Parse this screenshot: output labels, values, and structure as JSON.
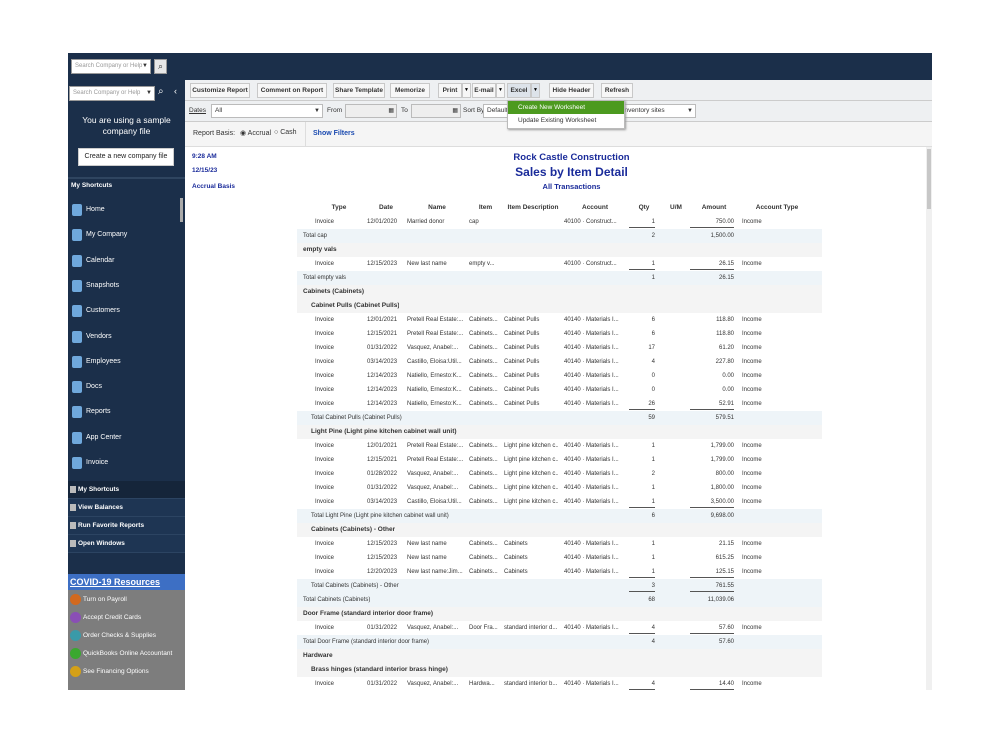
{
  "topbar": {
    "search_placeholder": "Search Company or Help"
  },
  "sidebar": {
    "search_placeholder": "Search Company or Help",
    "sample_text": "You are using a sample company file",
    "create_button": "Create a new company file",
    "shortcuts_header": "My Shortcuts",
    "items": [
      {
        "label": "Home"
      },
      {
        "label": "My Company"
      },
      {
        "label": "Calendar"
      },
      {
        "label": "Snapshots"
      },
      {
        "label": "Customers"
      },
      {
        "label": "Vendors"
      },
      {
        "label": "Employees"
      },
      {
        "label": "Docs"
      },
      {
        "label": "Reports"
      },
      {
        "label": "App Center"
      },
      {
        "label": "Invoice"
      }
    ],
    "bottom_nav": [
      {
        "label": "My Shortcuts"
      },
      {
        "label": "View Balances"
      },
      {
        "label": "Run Favorite Reports"
      },
      {
        "label": "Open Windows"
      }
    ],
    "covid_header": "COVID-19 Resources",
    "resources": [
      {
        "label": "Turn on Payroll",
        "color": "#d2691e"
      },
      {
        "label": "Accept Credit Cards",
        "color": "#8a4fb5"
      },
      {
        "label": "Order Checks & Supplies",
        "color": "#3a9aa8"
      },
      {
        "label": "QuickBooks Online Accountant",
        "color": "#3aa82f"
      },
      {
        "label": "See Financing Options",
        "color": "#d4a017"
      }
    ]
  },
  "toolbar": {
    "customize": "Customize Report",
    "comment": "Comment on Report",
    "share": "Share Template",
    "memorize": "Memorize",
    "print": "Print",
    "email": "E-mail",
    "excel": "Excel",
    "hide_header": "Hide Header",
    "refresh": "Refresh"
  },
  "excel_menu": {
    "items": [
      "Create New Worksheet",
      "Update Existing Worksheet"
    ]
  },
  "filters": {
    "dates_label": "Dates",
    "dates_value": "All",
    "from_label": "From",
    "to_label": "To",
    "sort_label": "Sort By",
    "sort_value": "Default",
    "sites_value": "All inventory sites"
  },
  "basis": {
    "label": "Report Basis:",
    "accrual": "Accrual",
    "cash": "Cash",
    "show_filters": "Show Filters"
  },
  "report": {
    "time": "9:28 AM",
    "date": "12/15/23",
    "basis": "Accrual Basis",
    "company": "Rock Castle Construction",
    "title": "Sales by Item Detail",
    "subtitle": "All Transactions",
    "columns": [
      "Type",
      "Date",
      "Name",
      "Item",
      "Item Description",
      "Account",
      "Qty",
      "U/M",
      "Amount",
      "Account Type"
    ],
    "rows": [
      {
        "k": "t",
        "c": [
          "Invoice",
          "12/01/2020",
          "Married donor",
          "cap",
          "",
          "40100 · Construct...",
          "1",
          "",
          "750.00",
          "Income"
        ],
        "u": 1
      },
      {
        "k": "s",
        "label": "Total cap",
        "qty": "2",
        "amt": "1,500.00"
      },
      {
        "k": "g",
        "label": "empty vals"
      },
      {
        "k": "t",
        "c": [
          "Invoice",
          "12/15/2023",
          "New last name",
          "empty v...",
          "",
          "40100 · Construct...",
          "1",
          "",
          "26.15",
          "Income"
        ],
        "u": 1
      },
      {
        "k": "s",
        "label": "Total empty vals",
        "qty": "1",
        "amt": "26.15"
      },
      {
        "k": "g",
        "label": "Cabinets (Cabinets)"
      },
      {
        "k": "g",
        "label": "Cabinet Pulls (Cabinet Pulls)",
        "i": 1
      },
      {
        "k": "t",
        "c": [
          "Invoice",
          "12/01/2021",
          "Pretell Real Estate:...",
          "Cabinets...",
          "Cabinet Pulls",
          "40140 · Materials I...",
          "6",
          "",
          "118.80",
          "Income"
        ]
      },
      {
        "k": "t",
        "c": [
          "Invoice",
          "12/15/2021",
          "Pretell Real Estate:...",
          "Cabinets...",
          "Cabinet Pulls",
          "40140 · Materials I...",
          "6",
          "",
          "118.80",
          "Income"
        ]
      },
      {
        "k": "t",
        "c": [
          "Invoice",
          "01/31/2022",
          "Vasquez, Anabel:...",
          "Cabinets...",
          "Cabinet Pulls",
          "40140 · Materials I...",
          "17",
          "",
          "61.20",
          "Income"
        ]
      },
      {
        "k": "t",
        "c": [
          "Invoice",
          "03/14/2023",
          "Castillo, Eloisa:Util...",
          "Cabinets...",
          "Cabinet Pulls",
          "40140 · Materials I...",
          "4",
          "",
          "227.80",
          "Income"
        ]
      },
      {
        "k": "t",
        "c": [
          "Invoice",
          "12/14/2023",
          "Natiello, Ernesto:K...",
          "Cabinets...",
          "Cabinet Pulls",
          "40140 · Materials I...",
          "0",
          "",
          "0.00",
          "Income"
        ]
      },
      {
        "k": "t",
        "c": [
          "Invoice",
          "12/14/2023",
          "Natiello, Ernesto:K...",
          "Cabinets...",
          "Cabinet Pulls",
          "40140 · Materials I...",
          "0",
          "",
          "0.00",
          "Income"
        ]
      },
      {
        "k": "t",
        "c": [
          "Invoice",
          "12/14/2023",
          "Natiello, Ernesto:K...",
          "Cabinets...",
          "Cabinet Pulls",
          "40140 · Materials I...",
          "26",
          "",
          "52.91",
          "Income"
        ],
        "u": 1
      },
      {
        "k": "s",
        "label": "Total Cabinet Pulls (Cabinet Pulls)",
        "qty": "59",
        "amt": "579.51",
        "i": 1
      },
      {
        "k": "g",
        "label": "Light Pine (Light pine kitchen cabinet wall unit)",
        "i": 1
      },
      {
        "k": "t",
        "c": [
          "Invoice",
          "12/01/2021",
          "Pretell Real Estate:...",
          "Cabinets...",
          "Light pine kitchen c...",
          "40140 · Materials I...",
          "1",
          "",
          "1,799.00",
          "Income"
        ]
      },
      {
        "k": "t",
        "c": [
          "Invoice",
          "12/15/2021",
          "Pretell Real Estate:...",
          "Cabinets...",
          "Light pine kitchen c...",
          "40140 · Materials I...",
          "1",
          "",
          "1,799.00",
          "Income"
        ]
      },
      {
        "k": "t",
        "c": [
          "Invoice",
          "01/28/2022",
          "Vasquez, Anabel:...",
          "Cabinets...",
          "Light pine kitchen c...",
          "40140 · Materials I...",
          "2",
          "",
          "800.00",
          "Income"
        ]
      },
      {
        "k": "t",
        "c": [
          "Invoice",
          "01/31/2022",
          "Vasquez, Anabel:...",
          "Cabinets...",
          "Light pine kitchen c...",
          "40140 · Materials I...",
          "1",
          "",
          "1,800.00",
          "Income"
        ]
      },
      {
        "k": "t",
        "c": [
          "Invoice",
          "03/14/2023",
          "Castillo, Eloisa:Util...",
          "Cabinets...",
          "Light pine kitchen c...",
          "40140 · Materials I...",
          "1",
          "",
          "3,500.00",
          "Income"
        ],
        "u": 1
      },
      {
        "k": "s",
        "label": "Total Light Pine (Light pine kitchen cabinet wall unit)",
        "qty": "6",
        "amt": "9,698.00",
        "i": 1
      },
      {
        "k": "g",
        "label": "Cabinets (Cabinets) - Other",
        "i": 1
      },
      {
        "k": "t",
        "c": [
          "Invoice",
          "12/15/2023",
          "New last name",
          "Cabinets...",
          "Cabinets",
          "40140 · Materials I...",
          "1",
          "",
          "21.15",
          "Income"
        ]
      },
      {
        "k": "t",
        "c": [
          "Invoice",
          "12/15/2023",
          "New last name",
          "Cabinets...",
          "Cabinets",
          "40140 · Materials I...",
          "1",
          "",
          "615.25",
          "Income"
        ]
      },
      {
        "k": "t",
        "c": [
          "Invoice",
          "12/20/2023",
          "New last name:Jim...",
          "Cabinets...",
          "Cabinets",
          "40140 · Materials I...",
          "1",
          "",
          "125.15",
          "Income"
        ],
        "u": 1
      },
      {
        "k": "s",
        "label": "Total Cabinets (Cabinets) - Other",
        "qty": "3",
        "amt": "761.55",
        "i": 1,
        "u": 1
      },
      {
        "k": "s",
        "label": "Total Cabinets (Cabinets)",
        "qty": "68",
        "amt": "11,039.06"
      },
      {
        "k": "g",
        "label": "Door Frame (standard interior door frame)"
      },
      {
        "k": "t",
        "c": [
          "Invoice",
          "01/31/2022",
          "Vasquez, Anabel:...",
          "Door Fra...",
          "standard interior d...",
          "40140 · Materials I...",
          "4",
          "",
          "57.60",
          "Income"
        ],
        "u": 1
      },
      {
        "k": "s",
        "label": "Total Door Frame (standard interior door frame)",
        "qty": "4",
        "amt": "57.60"
      },
      {
        "k": "g",
        "label": "Hardware"
      },
      {
        "k": "g",
        "label": "Brass hinges (standard interior brass hinge)",
        "i": 1
      },
      {
        "k": "t",
        "c": [
          "Invoice",
          "01/31/2022",
          "Vasquez, Anabel:...",
          "Hardwa...",
          "standard interior b...",
          "40140 · Materials I...",
          "4",
          "",
          "14.40",
          "Income"
        ],
        "u": 1
      }
    ]
  }
}
